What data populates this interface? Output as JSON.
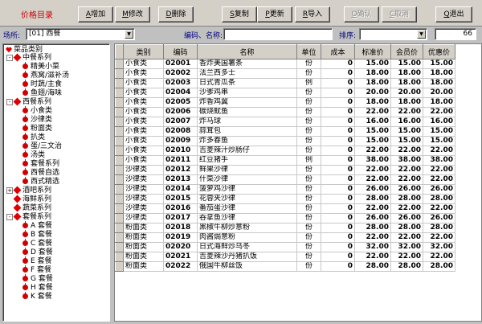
{
  "window": {
    "title": "价格目录"
  },
  "toolbar": {
    "buttons": [
      {
        "key": "A",
        "label": "增加",
        "disabled": false
      },
      {
        "key": "M",
        "label": "修改",
        "disabled": false
      },
      {
        "key": "D",
        "label": "删除",
        "disabled": false
      },
      {
        "key": "S",
        "label": "复制",
        "disabled": false
      },
      {
        "key": "P",
        "label": "更新",
        "disabled": false
      },
      {
        "key": "R",
        "label": "导入",
        "disabled": false
      },
      {
        "key": "O",
        "label": "确认",
        "disabled": true
      },
      {
        "key": "C",
        "label": "取消",
        "disabled": true
      },
      {
        "key": "Q",
        "label": "退出",
        "disabled": false
      }
    ]
  },
  "filter": {
    "venue_label": "场所:",
    "venue_value": "[01] 西餐",
    "search_label": "编码、名称:",
    "search_value": "",
    "sort_label": "排序:",
    "sort_value": "",
    "count": "66"
  },
  "tree": {
    "root": "菜品类别",
    "nodes": [
      {
        "level": 1,
        "label": "中餐系列",
        "expand": "-"
      },
      {
        "level": 2,
        "label": "精美小菜"
      },
      {
        "level": 2,
        "label": "燕窝/滋补汤"
      },
      {
        "level": 2,
        "label": "时蔬/主食"
      },
      {
        "level": 2,
        "label": "鱼翅/海味"
      },
      {
        "level": 1,
        "label": "西餐系列",
        "expand": "-"
      },
      {
        "level": 2,
        "label": "小食类"
      },
      {
        "level": 2,
        "label": "沙律类"
      },
      {
        "level": 2,
        "label": "粉面类"
      },
      {
        "level": 2,
        "label": "扒类"
      },
      {
        "level": 2,
        "label": "蛋/三文治"
      },
      {
        "level": 2,
        "label": "汤类"
      },
      {
        "level": 2,
        "label": "套餐系列"
      },
      {
        "level": 2,
        "label": "西餐自选"
      },
      {
        "level": 2,
        "label": "西式精选"
      },
      {
        "level": 1,
        "label": "酒吧系列",
        "expand": "+"
      },
      {
        "level": 1,
        "label": "海鲜系列",
        "expand": ""
      },
      {
        "level": 1,
        "label": "蔬菜系列",
        "expand": ""
      },
      {
        "level": 1,
        "label": "套餐系列",
        "expand": "-"
      },
      {
        "level": 2,
        "label": "A  套餐"
      },
      {
        "level": 2,
        "label": "B  套餐"
      },
      {
        "level": 2,
        "label": "C  套餐"
      },
      {
        "level": 2,
        "label": "D  套餐"
      },
      {
        "level": 2,
        "label": "E  套餐"
      },
      {
        "level": 2,
        "label": "F  套餐"
      },
      {
        "level": 2,
        "label": "G  套餐"
      },
      {
        "level": 2,
        "label": "H  套餐"
      },
      {
        "level": 2,
        "label": "K  套餐"
      }
    ]
  },
  "table": {
    "columns": [
      "类别",
      "编码",
      "名称",
      "单位",
      "成本",
      "标准价",
      "会员价",
      "优惠价"
    ],
    "rows": [
      [
        "小食类",
        "02001",
        "香炸美国薯条",
        "份",
        "0",
        "15.00",
        "15.00",
        "15.00"
      ],
      [
        "小食类",
        "02002",
        "法兰西多士",
        "份",
        "0",
        "18.00",
        "18.00",
        "18.00"
      ],
      [
        "小食类",
        "02003",
        "日式青瓜条",
        "例",
        "0",
        "18.00",
        "18.00",
        "18.00"
      ],
      [
        "小食类",
        "02004",
        "沙爹鸡串",
        "份",
        "0",
        "20.00",
        "20.00",
        "20.00"
      ],
      [
        "小食类",
        "02005",
        "炸香鸡翼",
        "份",
        "0",
        "18.00",
        "18.00",
        "18.00"
      ],
      [
        "小食类",
        "02006",
        "碳烧鱿鱼",
        "份",
        "0",
        "22.00",
        "22.00",
        "22.00"
      ],
      [
        "小食类",
        "02007",
        "炸马球",
        "份",
        "0",
        "16.00",
        "16.00",
        "16.00"
      ],
      [
        "小食类",
        "02008",
        "蒜茸包",
        "份",
        "0",
        "15.00",
        "15.00",
        "15.00"
      ],
      [
        "小食类",
        "02009",
        "炸多春鱼",
        "份",
        "0",
        "15.00",
        "15.00",
        "15.00"
      ],
      [
        "小食类",
        "02010",
        "吉菱辣汁炒肠仔",
        "份",
        "0",
        "22.00",
        "22.00",
        "22.00"
      ],
      [
        "小食类",
        "02011",
        "红豆猪手",
        "例",
        "0",
        "38.00",
        "38.00",
        "38.00"
      ],
      [
        "沙律类",
        "02012",
        "鲜果沙律",
        "份",
        "0",
        "22.00",
        "22.00",
        "22.00"
      ],
      [
        "沙律类",
        "02013",
        "什菜沙律",
        "份",
        "0",
        "22.00",
        "22.00",
        "22.00"
      ],
      [
        "沙律类",
        "02014",
        "菠萝鸡沙律",
        "份",
        "0",
        "26.00",
        "26.00",
        "26.00"
      ],
      [
        "沙律类",
        "02015",
        "花蓉夹沙律",
        "份",
        "0",
        "28.00",
        "28.00",
        "28.00"
      ],
      [
        "沙律类",
        "02016",
        "番茄蛋沙律",
        "份",
        "0",
        "22.00",
        "22.00",
        "22.00"
      ],
      [
        "沙律类",
        "02017",
        "吞拿鱼沙律",
        "份",
        "0",
        "26.00",
        "26.00",
        "26.00"
      ],
      [
        "粉面类",
        "02018",
        "黑椒牛柳炒意粉",
        "份",
        "0",
        "28.00",
        "28.00",
        "28.00"
      ],
      [
        "粉面类",
        "02019",
        "肉酱焗意粉",
        "份",
        "0",
        "22.00",
        "22.00",
        "22.00"
      ],
      [
        "粉面类",
        "02020",
        "日式海鲜炒乌冬",
        "份",
        "0",
        "32.00",
        "32.00",
        "32.00"
      ],
      [
        "粉面类",
        "02021",
        "吉菱辣沙丹猪扒饭",
        "份",
        "0",
        "22.00",
        "22.00",
        "22.00"
      ],
      [
        "粉面类",
        "02022",
        "俄国牛柳丝饭",
        "份",
        "0",
        "28.00",
        "28.00",
        "28.00"
      ]
    ]
  }
}
